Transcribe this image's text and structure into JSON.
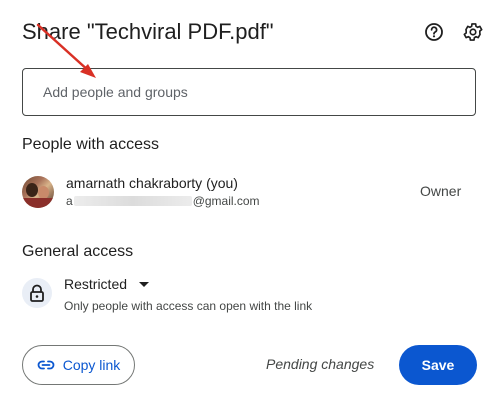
{
  "dialog": {
    "title": "Share \"Techviral PDF.pdf\"",
    "help_icon": "help-circle-icon",
    "settings_icon": "gear-icon"
  },
  "add_people": {
    "placeholder": "Add people and groups",
    "value": ""
  },
  "people_with_access": {
    "heading": "People with access",
    "people": [
      {
        "name": "amarnath chakraborty (you)",
        "email_prefix": "a",
        "email_suffix": "@gmail.com",
        "role": "Owner",
        "avatar": "user-photo-avatar"
      }
    ]
  },
  "general_access": {
    "heading": "General access",
    "level": "Restricted",
    "description": "Only people with access can open with the link",
    "icon": "lock-icon"
  },
  "footer": {
    "copy_link_label": "Copy link",
    "copy_link_icon": "link-icon",
    "pending_text": "Pending changes",
    "save_label": "Save"
  },
  "colors": {
    "accent": "#0b57d0",
    "annotation_arrow": "#d93025",
    "lock_bg": "#e9eef6"
  }
}
